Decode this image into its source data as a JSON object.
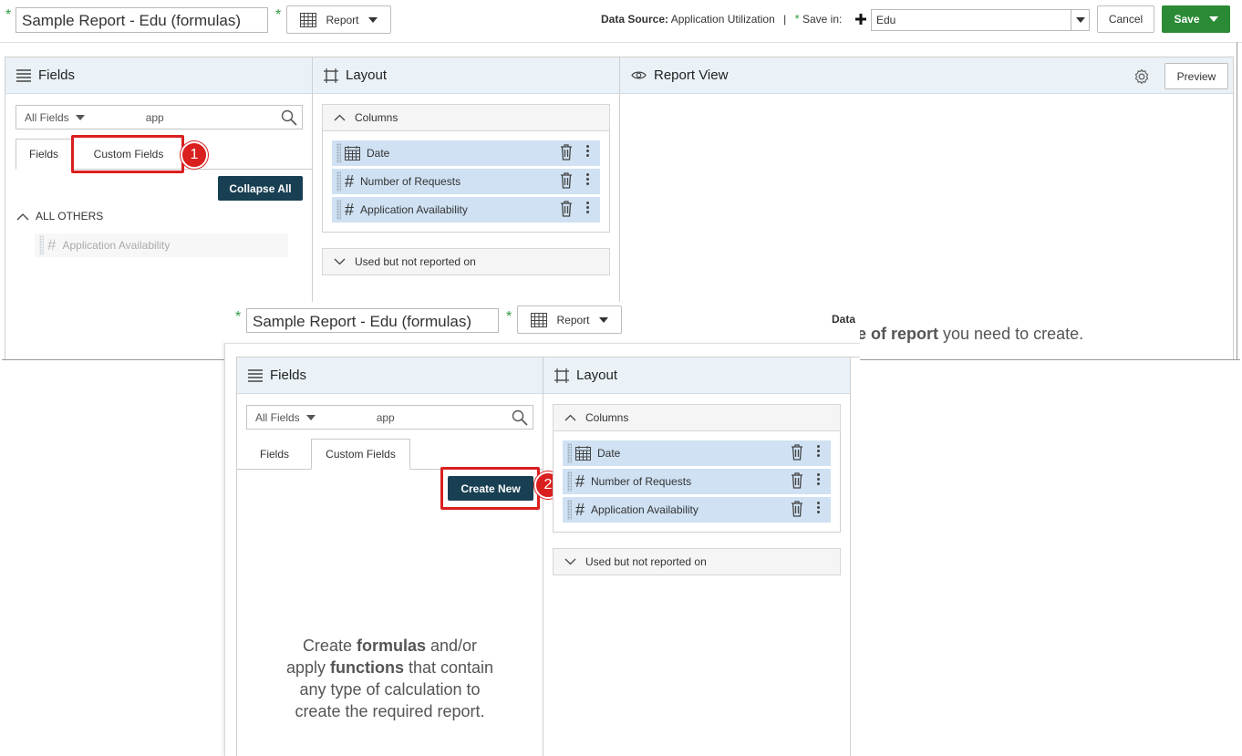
{
  "top": {
    "report_name": "Sample Report - Edu (formulas)",
    "report_type": "Report",
    "data_source_label": "Data Source:",
    "data_source_value": "Application Utilization",
    "separator": "|",
    "save_in_label": "Save in:",
    "save_in_value": "Edu",
    "cancel_label": "Cancel",
    "save_label": "Save"
  },
  "fields_panel": {
    "title": "Fields",
    "filter_label": "All Fields",
    "search_value": "app",
    "tab_fields": "Fields",
    "tab_custom": "Custom Fields",
    "collapse_all": "Collapse All",
    "group_label": "ALL OTHERS",
    "group_item": "Application Availability"
  },
  "layout_panel": {
    "title": "Layout",
    "columns_label": "Columns",
    "columns": [
      "Date",
      "Number of Requests",
      "Application Availability"
    ],
    "used_label": "Used but not reported on"
  },
  "report_view": {
    "title": "Report View",
    "preview_label": "Preview",
    "hint_bold": "e of report",
    "hint_rest": " you need to create."
  },
  "overlay": {
    "report_name": "Sample Report - Edu (formulas)",
    "report_type": "Report",
    "data_fragment": "Data",
    "fields_title": "Fields",
    "filter_label": "All Fields",
    "search_value": "app",
    "tab_fields": "Fields",
    "tab_custom": "Custom Fields",
    "create_new": "Create New",
    "layout_title": "Layout",
    "columns_label": "Columns",
    "columns": [
      "Date",
      "Number of Requests",
      "Application Availability"
    ],
    "used_label": "Used but not reported on",
    "msg": {
      "p1": "Create ",
      "b1": "formulas",
      "p2": " and/or",
      "p3": "apply ",
      "b2": "functions",
      "p4": " that contain",
      "p5": "any type of calculation to",
      "p6": "create the required report."
    }
  },
  "callouts": [
    "1",
    "2"
  ],
  "required_mark": "*",
  "colors": {
    "accent_dark": "#183f52",
    "save_green": "#2a8a35",
    "callout_red": "#d9201f",
    "panel_header": "#eaf2f8",
    "column_item": "#cfe1f3"
  }
}
